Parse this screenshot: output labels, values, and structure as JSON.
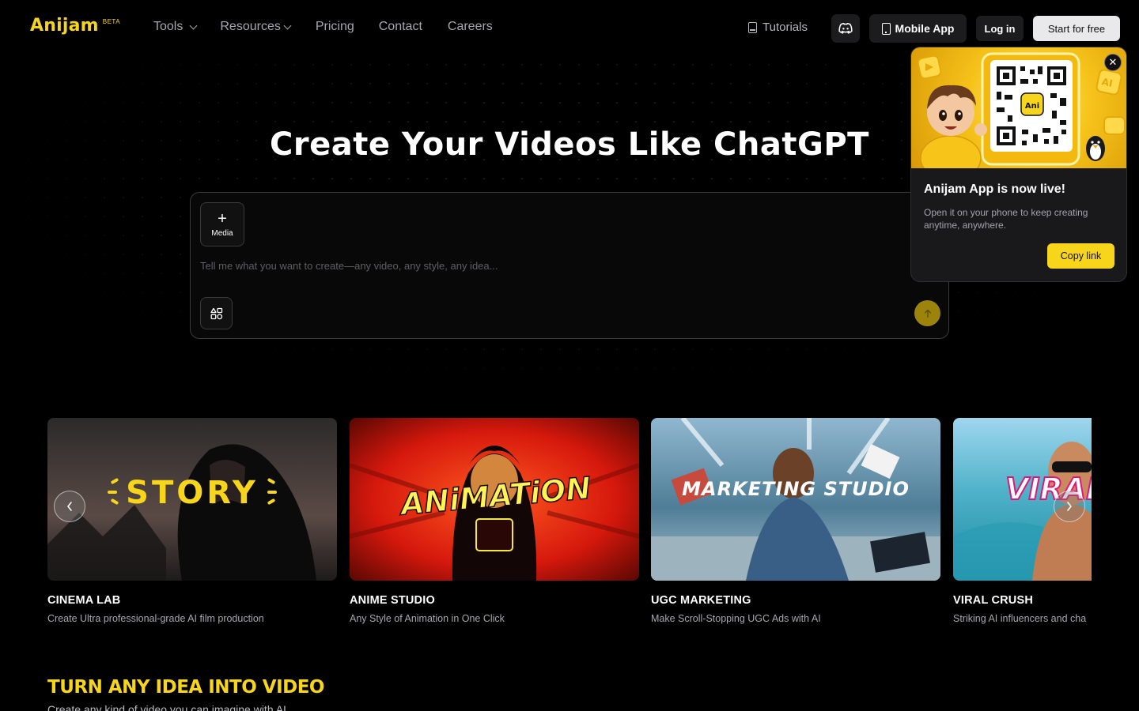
{
  "nav": {
    "logo": "Anijam",
    "beta": "BETA",
    "links": [
      {
        "label": "Tools",
        "has_dropdown": true
      },
      {
        "label": "Resources",
        "has_dropdown": true
      },
      {
        "label": "Pricing"
      },
      {
        "label": "Contact"
      },
      {
        "label": "Careers"
      }
    ],
    "tutorials": "Tutorials",
    "discord_icon": "discord-icon",
    "mobile_app": "Mobile App",
    "login": "Log in",
    "start": "Start for free"
  },
  "hero": {
    "title": "Create Your Videos Like ChatGPT",
    "media_label": "Media",
    "placeholder": "Tell me what you want to create—any video, any style, any idea..."
  },
  "popup": {
    "title": "Anijam App is now live!",
    "description": "Open it on your phone to keep creating anytime, anywhere.",
    "copy_label": "Copy link",
    "qr_badge": "Ani",
    "badge_ai": "AI"
  },
  "cards": [
    {
      "title": "CINEMA LAB",
      "description": "Create Ultra professional-grade AI film production",
      "overlay": "STORY"
    },
    {
      "title": "ANIME STUDIO",
      "description": "Any Style of Animation in One Click",
      "overlay": "ANiMATiON"
    },
    {
      "title": "UGC MARKETING",
      "description": "Make Scroll-Stopping UGC Ads with AI",
      "overlay": "MARKETING STUDIO"
    },
    {
      "title": "VIRAL CRUSH",
      "description": "Striking AI influencers and cha",
      "overlay": "VIRAL"
    }
  ],
  "section": {
    "title": "TURN ANY IDEA INTO VIDEO",
    "subtitle": "Create any kind of video you can imagine with AI"
  },
  "colors": {
    "accent": "#f7d51b",
    "background": "#000000",
    "send_button": "#9c840c"
  }
}
